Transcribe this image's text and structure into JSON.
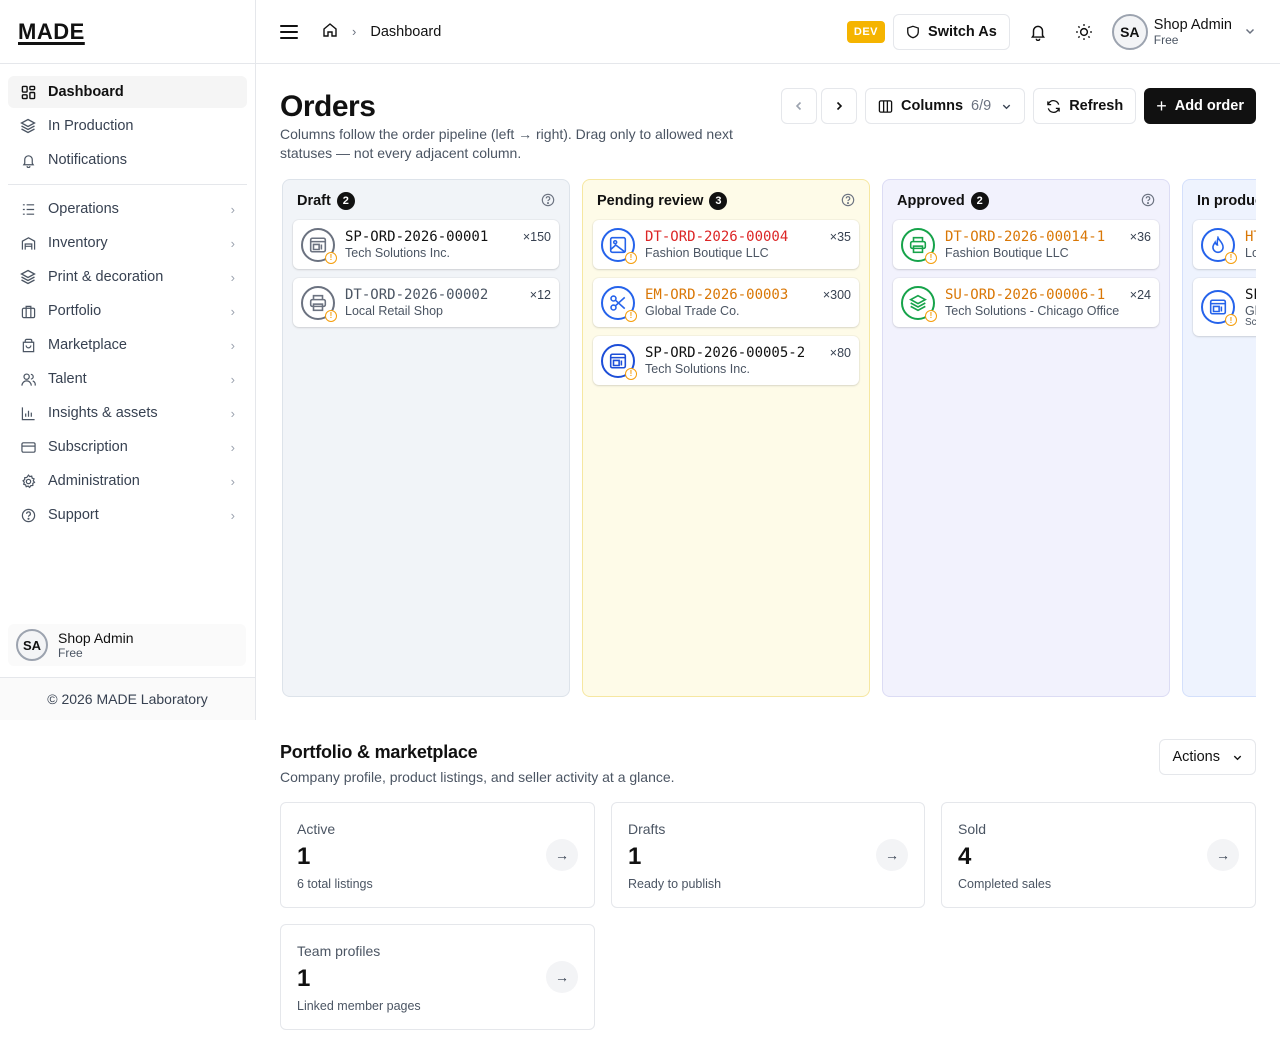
{
  "app": {
    "logo": "MADE"
  },
  "sidebar": {
    "items": [
      {
        "label": "Dashboard",
        "icon": "grid-icon",
        "active": true,
        "chevron": false
      },
      {
        "label": "In Production",
        "icon": "layers-icon",
        "active": false,
        "chevron": false
      },
      {
        "label": "Notifications",
        "icon": "bell-icon",
        "active": false,
        "chevron": false
      }
    ],
    "groups": [
      {
        "label": "Operations",
        "icon": "list-icon"
      },
      {
        "label": "Inventory",
        "icon": "warehouse-icon"
      },
      {
        "label": "Print & decoration",
        "icon": "layers-icon"
      },
      {
        "label": "Portfolio",
        "icon": "briefcase-icon"
      },
      {
        "label": "Marketplace",
        "icon": "store-icon"
      },
      {
        "label": "Talent",
        "icon": "users-icon"
      },
      {
        "label": "Insights & assets",
        "icon": "bar-chart-icon"
      },
      {
        "label": "Subscription",
        "icon": "credit-card-icon"
      },
      {
        "label": "Administration",
        "icon": "gear-icon"
      },
      {
        "label": "Support",
        "icon": "help-icon"
      }
    ],
    "user": {
      "initials": "SA",
      "name": "Shop Admin",
      "plan": "Free"
    },
    "footer": "© 2026 MADE Laboratory"
  },
  "topbar": {
    "breadcrumb": "Dashboard",
    "env_badge": "DEV",
    "switch_as": "Switch As",
    "user": {
      "initials": "SA",
      "name": "Shop Admin",
      "plan": "Free"
    }
  },
  "orders": {
    "title": "Orders",
    "description": "Columns follow the order pipeline (left → right). Drag only to allowed next statuses — not every adjacent column.",
    "columns_label": "Columns",
    "columns_count": "6/9",
    "refresh_label": "Refresh",
    "add_label": "Add order",
    "columns": [
      {
        "title": "Draft",
        "count": "2",
        "bg": "#f1f4f8",
        "border": "#dde3ea",
        "cards": [
          {
            "id": "SP-ORD-2026-00001",
            "customer": "Tech Solutions Inc.",
            "qty": "×150",
            "id_color": "#111111",
            "icon": "screen-print-icon",
            "ring": "#6b7280"
          },
          {
            "id": "DT-ORD-2026-00002",
            "customer": "Local Retail Shop",
            "qty": "×12",
            "id_color": "#4b5563",
            "icon": "printer-icon",
            "ring": "#6b7280"
          }
        ]
      },
      {
        "title": "Pending review",
        "count": "3",
        "bg": "#fefbe8",
        "border": "#f6e7a1",
        "cards": [
          {
            "id": "DT-ORD-2026-00004",
            "customer": "Fashion Boutique LLC",
            "qty": "×35",
            "id_color": "#dc2626",
            "icon": "image-icon",
            "ring": "#2563eb"
          },
          {
            "id": "EM-ORD-2026-00003",
            "customer": "Global Trade Co.",
            "qty": "×300",
            "id_color": "#d97706",
            "icon": "scissors-icon",
            "ring": "#2563eb"
          },
          {
            "id": "SP-ORD-2026-00005-2",
            "customer": "Tech Solutions Inc.",
            "qty": "×80",
            "id_color": "#111111",
            "icon": "screen-print-icon",
            "ring": "#1d4ed8"
          }
        ]
      },
      {
        "title": "Approved",
        "count": "2",
        "bg": "#f2f2fd",
        "border": "#dcdcf4",
        "cards": [
          {
            "id": "DT-ORD-2026-00014-1",
            "customer": "Fashion Boutique LLC",
            "qty": "×36",
            "id_color": "#d97706",
            "icon": "printer-icon",
            "ring": "#16a34a"
          },
          {
            "id": "SU-ORD-2026-00006-1",
            "customer": "Tech Solutions - Chicago Office",
            "qty": "×24",
            "id_color": "#d97706",
            "icon": "layers-icon",
            "ring": "#16a34a"
          }
        ]
      },
      {
        "title": "In production",
        "count": "",
        "bg": "#eef3fe",
        "border": "#d4e0fb",
        "cards": [
          {
            "id": "HT",
            "customer": "Lo",
            "qty": "",
            "id_color": "#d97706",
            "icon": "flame-icon",
            "ring": "#2563eb"
          },
          {
            "id": "SP",
            "customer": "Gl",
            "qty": "",
            "id_color": "#111111",
            "icon": "screen-print-icon",
            "ring": "#2563eb",
            "extra": "Scr"
          }
        ]
      }
    ]
  },
  "portfolio": {
    "title": "Portfolio & marketplace",
    "description": "Company profile, product listings, and seller activity at a glance.",
    "actions_label": "Actions",
    "stats": [
      {
        "label": "Active",
        "value": "1",
        "sub": "6 total listings"
      },
      {
        "label": "Drafts",
        "value": "1",
        "sub": "Ready to publish"
      },
      {
        "label": "Sold",
        "value": "4",
        "sub": "Completed sales"
      },
      {
        "label": "Team profiles",
        "value": "1",
        "sub": "Linked member pages"
      }
    ]
  }
}
